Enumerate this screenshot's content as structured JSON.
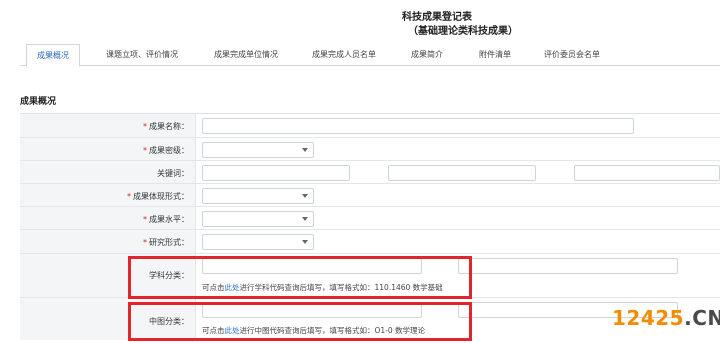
{
  "header": {
    "title": "科技成果登记表",
    "subtitle": "（基础理论类科技成果）"
  },
  "tabs": [
    {
      "label": "成果概况",
      "active": true
    },
    {
      "label": "课题立项、评价情况",
      "active": false
    },
    {
      "label": "成果完成单位情况",
      "active": false
    },
    {
      "label": "成果完成人员名单",
      "active": false
    },
    {
      "label": "成果简介",
      "active": false
    },
    {
      "label": "附件清单",
      "active": false
    },
    {
      "label": "评价委员会名单",
      "active": false
    }
  ],
  "section": {
    "title": "成果概况"
  },
  "form": {
    "required_mark": "*",
    "fields": {
      "name": {
        "label": "成果名称：",
        "required": true,
        "value": ""
      },
      "secret_level": {
        "label": "成果密级：",
        "required": true,
        "value": ""
      },
      "keywords": {
        "label": "关键词：",
        "required": false,
        "values": [
          "",
          "",
          ""
        ]
      },
      "form_type": {
        "label": "成果体现形式：",
        "required": true,
        "value": ""
      },
      "level": {
        "label": "成果水平：",
        "required": true,
        "value": ""
      },
      "research_type": {
        "label": "研究形式：",
        "required": true,
        "value": ""
      },
      "discipline": {
        "label": "学科分类：",
        "required": false,
        "hint_prefix": "可点击",
        "hint_link": "此处",
        "hint_suffix": "进行学科代码查询后填写，填写格式如：110.1460 数学基础"
      },
      "clc": {
        "label": "中图分类：",
        "required": false,
        "hint_prefix": "可点击",
        "hint_link": "此处",
        "hint_suffix": "进行中图代码查询后填写，填写格式如：O1-0 数学理论"
      }
    }
  },
  "watermark": {
    "num": "12425",
    "suffix": ".CN"
  },
  "colors": {
    "accent": "#2b6cc4",
    "required": "#e02020",
    "highlight": "#e2252b",
    "watermark": "#f28c00"
  }
}
